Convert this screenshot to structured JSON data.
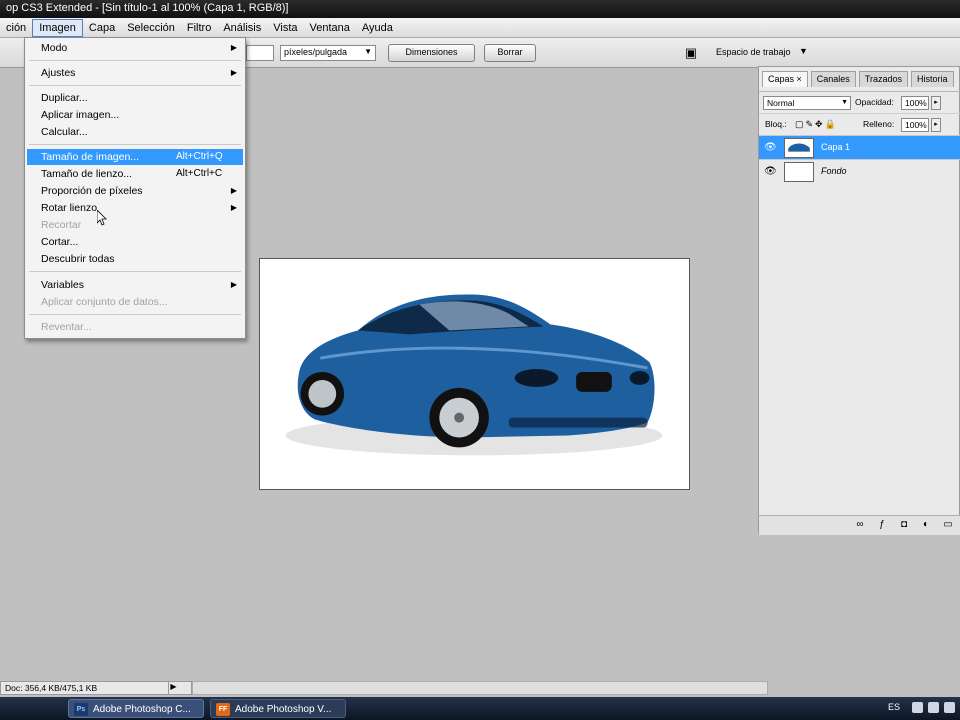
{
  "window": {
    "title": "op CS3 Extended - [Sin título-1 al 100% (Capa 1, RGB/8)]"
  },
  "menubar": {
    "items": [
      {
        "label": "ción",
        "active": false
      },
      {
        "label": "Imagen",
        "active": true
      },
      {
        "label": "Capa",
        "active": false
      },
      {
        "label": "Selección",
        "active": false
      },
      {
        "label": "Filtro",
        "active": false
      },
      {
        "label": "Análisis",
        "active": false
      },
      {
        "label": "Vista",
        "active": false
      },
      {
        "label": "Ventana",
        "active": false
      },
      {
        "label": "Ayuda",
        "active": false
      }
    ]
  },
  "options": {
    "resolution_unit": "píxeles/pulgada",
    "dimensions_button": "Dimensiones",
    "clear_button": "Borrar",
    "workspace_label": "Espacio de trabajo"
  },
  "image_menu": {
    "items": [
      {
        "label": "Modo",
        "shortcut": "",
        "submenu": true,
        "disabled": false,
        "highlighted": false
      },
      {
        "label": "Ajustes",
        "shortcut": "",
        "submenu": true,
        "disabled": false,
        "highlighted": false
      },
      {
        "label": "Duplicar...",
        "shortcut": "",
        "submenu": false,
        "disabled": false,
        "highlighted": false
      },
      {
        "label": "Aplicar imagen...",
        "shortcut": "",
        "submenu": false,
        "disabled": false,
        "highlighted": false
      },
      {
        "label": "Calcular...",
        "shortcut": "",
        "submenu": false,
        "disabled": false,
        "highlighted": false
      },
      {
        "label": "Tamaño de imagen...",
        "shortcut": "Alt+Ctrl+Q",
        "submenu": false,
        "disabled": false,
        "highlighted": true
      },
      {
        "label": "Tamaño de lienzo...",
        "shortcut": "Alt+Ctrl+C",
        "submenu": false,
        "disabled": false,
        "highlighted": false
      },
      {
        "label": "Proporción de píxeles",
        "shortcut": "",
        "submenu": true,
        "disabled": false,
        "highlighted": false
      },
      {
        "label": "Rotar lienzo",
        "shortcut": "",
        "submenu": true,
        "disabled": false,
        "highlighted": false
      },
      {
        "label": "Recortar",
        "shortcut": "",
        "submenu": false,
        "disabled": true,
        "highlighted": false
      },
      {
        "label": "Cortar...",
        "shortcut": "",
        "submenu": false,
        "disabled": false,
        "highlighted": false
      },
      {
        "label": "Descubrir todas",
        "shortcut": "",
        "submenu": false,
        "disabled": false,
        "highlighted": false
      },
      {
        "label": "Variables",
        "shortcut": "",
        "submenu": true,
        "disabled": false,
        "highlighted": false
      },
      {
        "label": "Aplicar conjunto de datos...",
        "shortcut": "",
        "submenu": false,
        "disabled": true,
        "highlighted": false
      },
      {
        "label": "Reventar...",
        "shortcut": "",
        "submenu": false,
        "disabled": true,
        "highlighted": false
      }
    ]
  },
  "layers_panel": {
    "tabs": [
      {
        "label": "Capas ×",
        "active": true
      },
      {
        "label": "Canales",
        "active": false
      },
      {
        "label": "Trazados",
        "active": false
      },
      {
        "label": "Historia",
        "active": false
      }
    ],
    "blend_mode": "Normal",
    "opacity_label": "Opacidad:",
    "opacity_value": "100%",
    "lock_label": "Bloq.:",
    "fill_label": "Relleno:",
    "fill_value": "100%",
    "layers": [
      {
        "name": "Capa 1",
        "selected": true,
        "italic": false
      },
      {
        "name": "Fondo",
        "selected": false,
        "italic": true
      }
    ]
  },
  "status": {
    "doc_info": "Doc: 356,4 KB/475,1 KB"
  },
  "taskbar": {
    "tasks": [
      {
        "label": "Adobe Photoshop C...",
        "icon": "Ps"
      },
      {
        "label": "Adobe Photoshop V...",
        "icon": "FF"
      }
    ],
    "language": "ES"
  },
  "colors": {
    "highlight": "#3399ff",
    "car_body": "#1e5fa0"
  }
}
